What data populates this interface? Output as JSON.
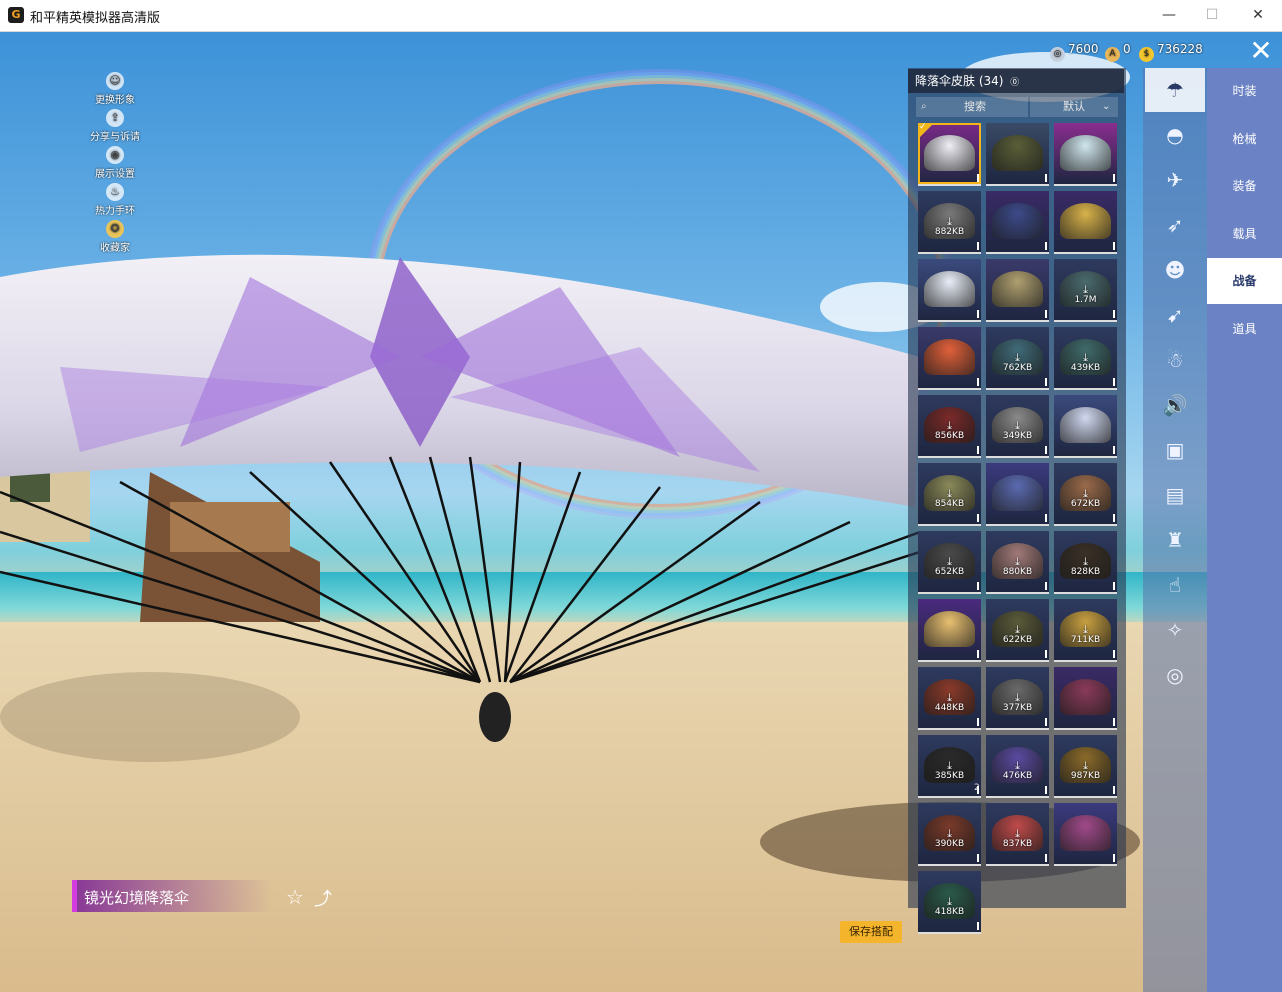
{
  "window": {
    "title": "和平精英模拟器高清版",
    "icon": "G",
    "minimize": "—",
    "maximize": "☐",
    "close": "✕"
  },
  "currency": [
    {
      "icon": "silver-coin-icon",
      "value": "7600",
      "color": "#c7d2e0"
    },
    {
      "icon": "a-coin-icon",
      "value": "0",
      "color": "#e9b65a"
    },
    {
      "icon": "gold-coin-icon",
      "value": "736228",
      "color": "#f4c730"
    }
  ],
  "left_menu": [
    {
      "label": "更换形象",
      "icon": "avatar-icon",
      "glyph": "☺"
    },
    {
      "label": "分享与诉请",
      "icon": "share-hub-icon",
      "glyph": "⇪"
    },
    {
      "label": "展示设置",
      "icon": "eye-icon",
      "glyph": "◉"
    },
    {
      "label": "热力手环",
      "icon": "flame-icon",
      "glyph": "♨"
    },
    {
      "label": "收藏家",
      "icon": "collector-badge-icon",
      "glyph": "✪"
    }
  ],
  "selected_item": {
    "name": "镜光幻境降落伞",
    "favorite_icon": "☆",
    "share_icon": "⤴"
  },
  "save_button": "保存搭配",
  "panel": {
    "title": "降落伞皮肤 (34)",
    "help_glyph": "⓪",
    "search_placeholder": "搜索",
    "sort_value": "默认",
    "sort_chevron": "⌄"
  },
  "skins": [
    {
      "size": "",
      "bg": "#7a2a88",
      "canopy": "#f0eef6",
      "owned": true,
      "selected": true
    },
    {
      "size": "",
      "bg": "#3a4a66",
      "canopy": "#5a5f38",
      "owned": true
    },
    {
      "size": "",
      "bg": "#8a2d8f",
      "canopy": "#cfe6ee",
      "owned": true
    },
    {
      "size": "882KB",
      "bg": "#2e3a5e",
      "canopy": "#7a7a7a"
    },
    {
      "size": "",
      "bg": "#3a2a66",
      "canopy": "#3c4a8a",
      "owned": true
    },
    {
      "size": "",
      "bg": "#3a2a66",
      "canopy": "#d8b24a",
      "owned": true
    },
    {
      "size": "",
      "bg": "#3b4a7e",
      "canopy": "#e8eef8",
      "owned": true
    },
    {
      "size": "",
      "bg": "#3a3a6a",
      "canopy": "#b0a070",
      "owned": true
    },
    {
      "size": "1.7M",
      "bg": "#2e3a5e",
      "canopy": "#4a6a6e"
    },
    {
      "size": "",
      "bg": "#3a3a6a",
      "canopy": "#e0603a",
      "owned": true
    },
    {
      "size": "762KB",
      "bg": "#2e3a5e",
      "canopy": "#3f6a78"
    },
    {
      "size": "439KB",
      "bg": "#2e3a5e",
      "canopy": "#3f6a6a"
    },
    {
      "size": "856KB",
      "bg": "#2e3a5e",
      "canopy": "#7a2a2a"
    },
    {
      "size": "349KB",
      "bg": "#2e3a5e",
      "canopy": "#8a8a8a"
    },
    {
      "size": "",
      "bg": "#3b4a7e",
      "canopy": "#d0d8f0",
      "owned": true
    },
    {
      "size": "854KB",
      "bg": "#2e3a5e",
      "canopy": "#8a8a5a"
    },
    {
      "size": "",
      "bg": "#3b3a7e",
      "canopy": "#5a6ab0",
      "owned": true
    },
    {
      "size": "672KB",
      "bg": "#2e3a5e",
      "canopy": "#9a6a4a"
    },
    {
      "size": "652KB",
      "bg": "#2e3a5e",
      "canopy": "#4a4a4a"
    },
    {
      "size": "880KB",
      "bg": "#2e3a5e",
      "canopy": "#a07a78"
    },
    {
      "size": "828KB",
      "bg": "#2e3a5e",
      "canopy": "#3a3026"
    },
    {
      "size": "",
      "bg": "#4a2a7e",
      "canopy": "#e8c070",
      "owned": true
    },
    {
      "size": "622KB",
      "bg": "#2e3a5e",
      "canopy": "#5a5a3a"
    },
    {
      "size": "711KB",
      "bg": "#2e3a5e",
      "canopy": "#c8a040"
    },
    {
      "size": "448KB",
      "bg": "#2e3a5e",
      "canopy": "#8a3a2a"
    },
    {
      "size": "377KB",
      "bg": "#2e3a5e",
      "canopy": "#6a6a6a"
    },
    {
      "size": "",
      "bg": "#3a2a66",
      "canopy": "#8a3a5a",
      "owned": true
    },
    {
      "size": "385KB",
      "bg": "#2e3a5e",
      "canopy": "#2a2a2a",
      "count": "2"
    },
    {
      "size": "476KB",
      "bg": "#2e3a5e",
      "canopy": "#5a4aa0"
    },
    {
      "size": "987KB",
      "bg": "#2e3a5e",
      "canopy": "#8a6a2a"
    },
    {
      "size": "390KB",
      "bg": "#2e3a5e",
      "canopy": "#7a3a2a"
    },
    {
      "size": "837KB",
      "bg": "#2e3a5e",
      "canopy": "#c04a4a"
    },
    {
      "size": "",
      "bg": "#3b3a7e",
      "canopy": "#a04a8a",
      "owned": true
    },
    {
      "size": "418KB",
      "bg": "#2e3a5e",
      "canopy": "#2a5a4a"
    }
  ],
  "categories": [
    {
      "icon": "parachute-icon",
      "glyph": "☂",
      "active": true
    },
    {
      "icon": "backpack-skin-icon",
      "glyph": "◓"
    },
    {
      "icon": "plane-skin-icon",
      "glyph": "✈"
    },
    {
      "icon": "glider-icon",
      "glyph": "➶"
    },
    {
      "icon": "emote-icon",
      "glyph": "☻"
    },
    {
      "icon": "jet-icon",
      "glyph": "➹"
    },
    {
      "icon": "pet-icon",
      "glyph": "☃"
    },
    {
      "icon": "sound-icon",
      "glyph": "🔊"
    },
    {
      "icon": "badge-icon",
      "glyph": "▣"
    },
    {
      "icon": "gallery-icon",
      "glyph": "▤"
    },
    {
      "icon": "extinguisher-icon",
      "glyph": "♜"
    },
    {
      "icon": "tap-icon",
      "glyph": "☝"
    },
    {
      "icon": "magic-wand-icon",
      "glyph": "✧"
    },
    {
      "icon": "ufo-icon",
      "glyph": "◎"
    }
  ],
  "tabs": [
    {
      "label": "时装"
    },
    {
      "label": "枪械"
    },
    {
      "label": "装备"
    },
    {
      "label": "载具"
    },
    {
      "label": "战备",
      "active": true
    },
    {
      "label": "道具"
    }
  ]
}
